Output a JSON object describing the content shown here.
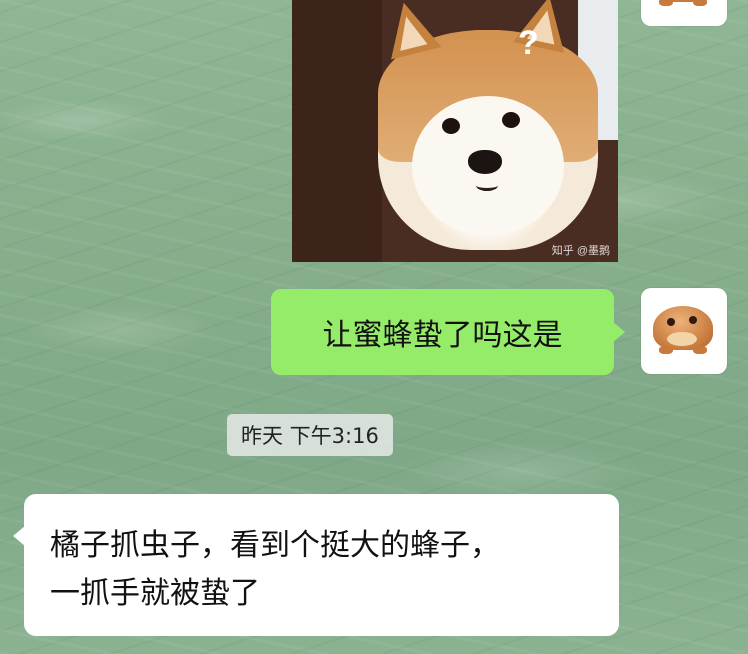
{
  "chat": {
    "messages": [
      {
        "type": "sticker",
        "side": "sent",
        "description_icon": "shiba-dog-sticker",
        "question_mark": "?",
        "watermark": "知乎 @墨鹅"
      },
      {
        "type": "text",
        "side": "sent",
        "text": "让蜜蜂蛰了吗这是"
      },
      {
        "type": "timestamp",
        "text": "昨天 下午3:16"
      },
      {
        "type": "text",
        "side": "received",
        "lines": [
          "橘子抓虫子，看到个挺大的蜂子，",
          "一抓手就被蛰了"
        ]
      }
    ]
  },
  "avatars": {
    "self_icon": "frog-avatar-icon"
  },
  "colors": {
    "sent_bubble": "#95ec69",
    "received_bubble": "#ffffff",
    "background": "#86ae8b"
  }
}
